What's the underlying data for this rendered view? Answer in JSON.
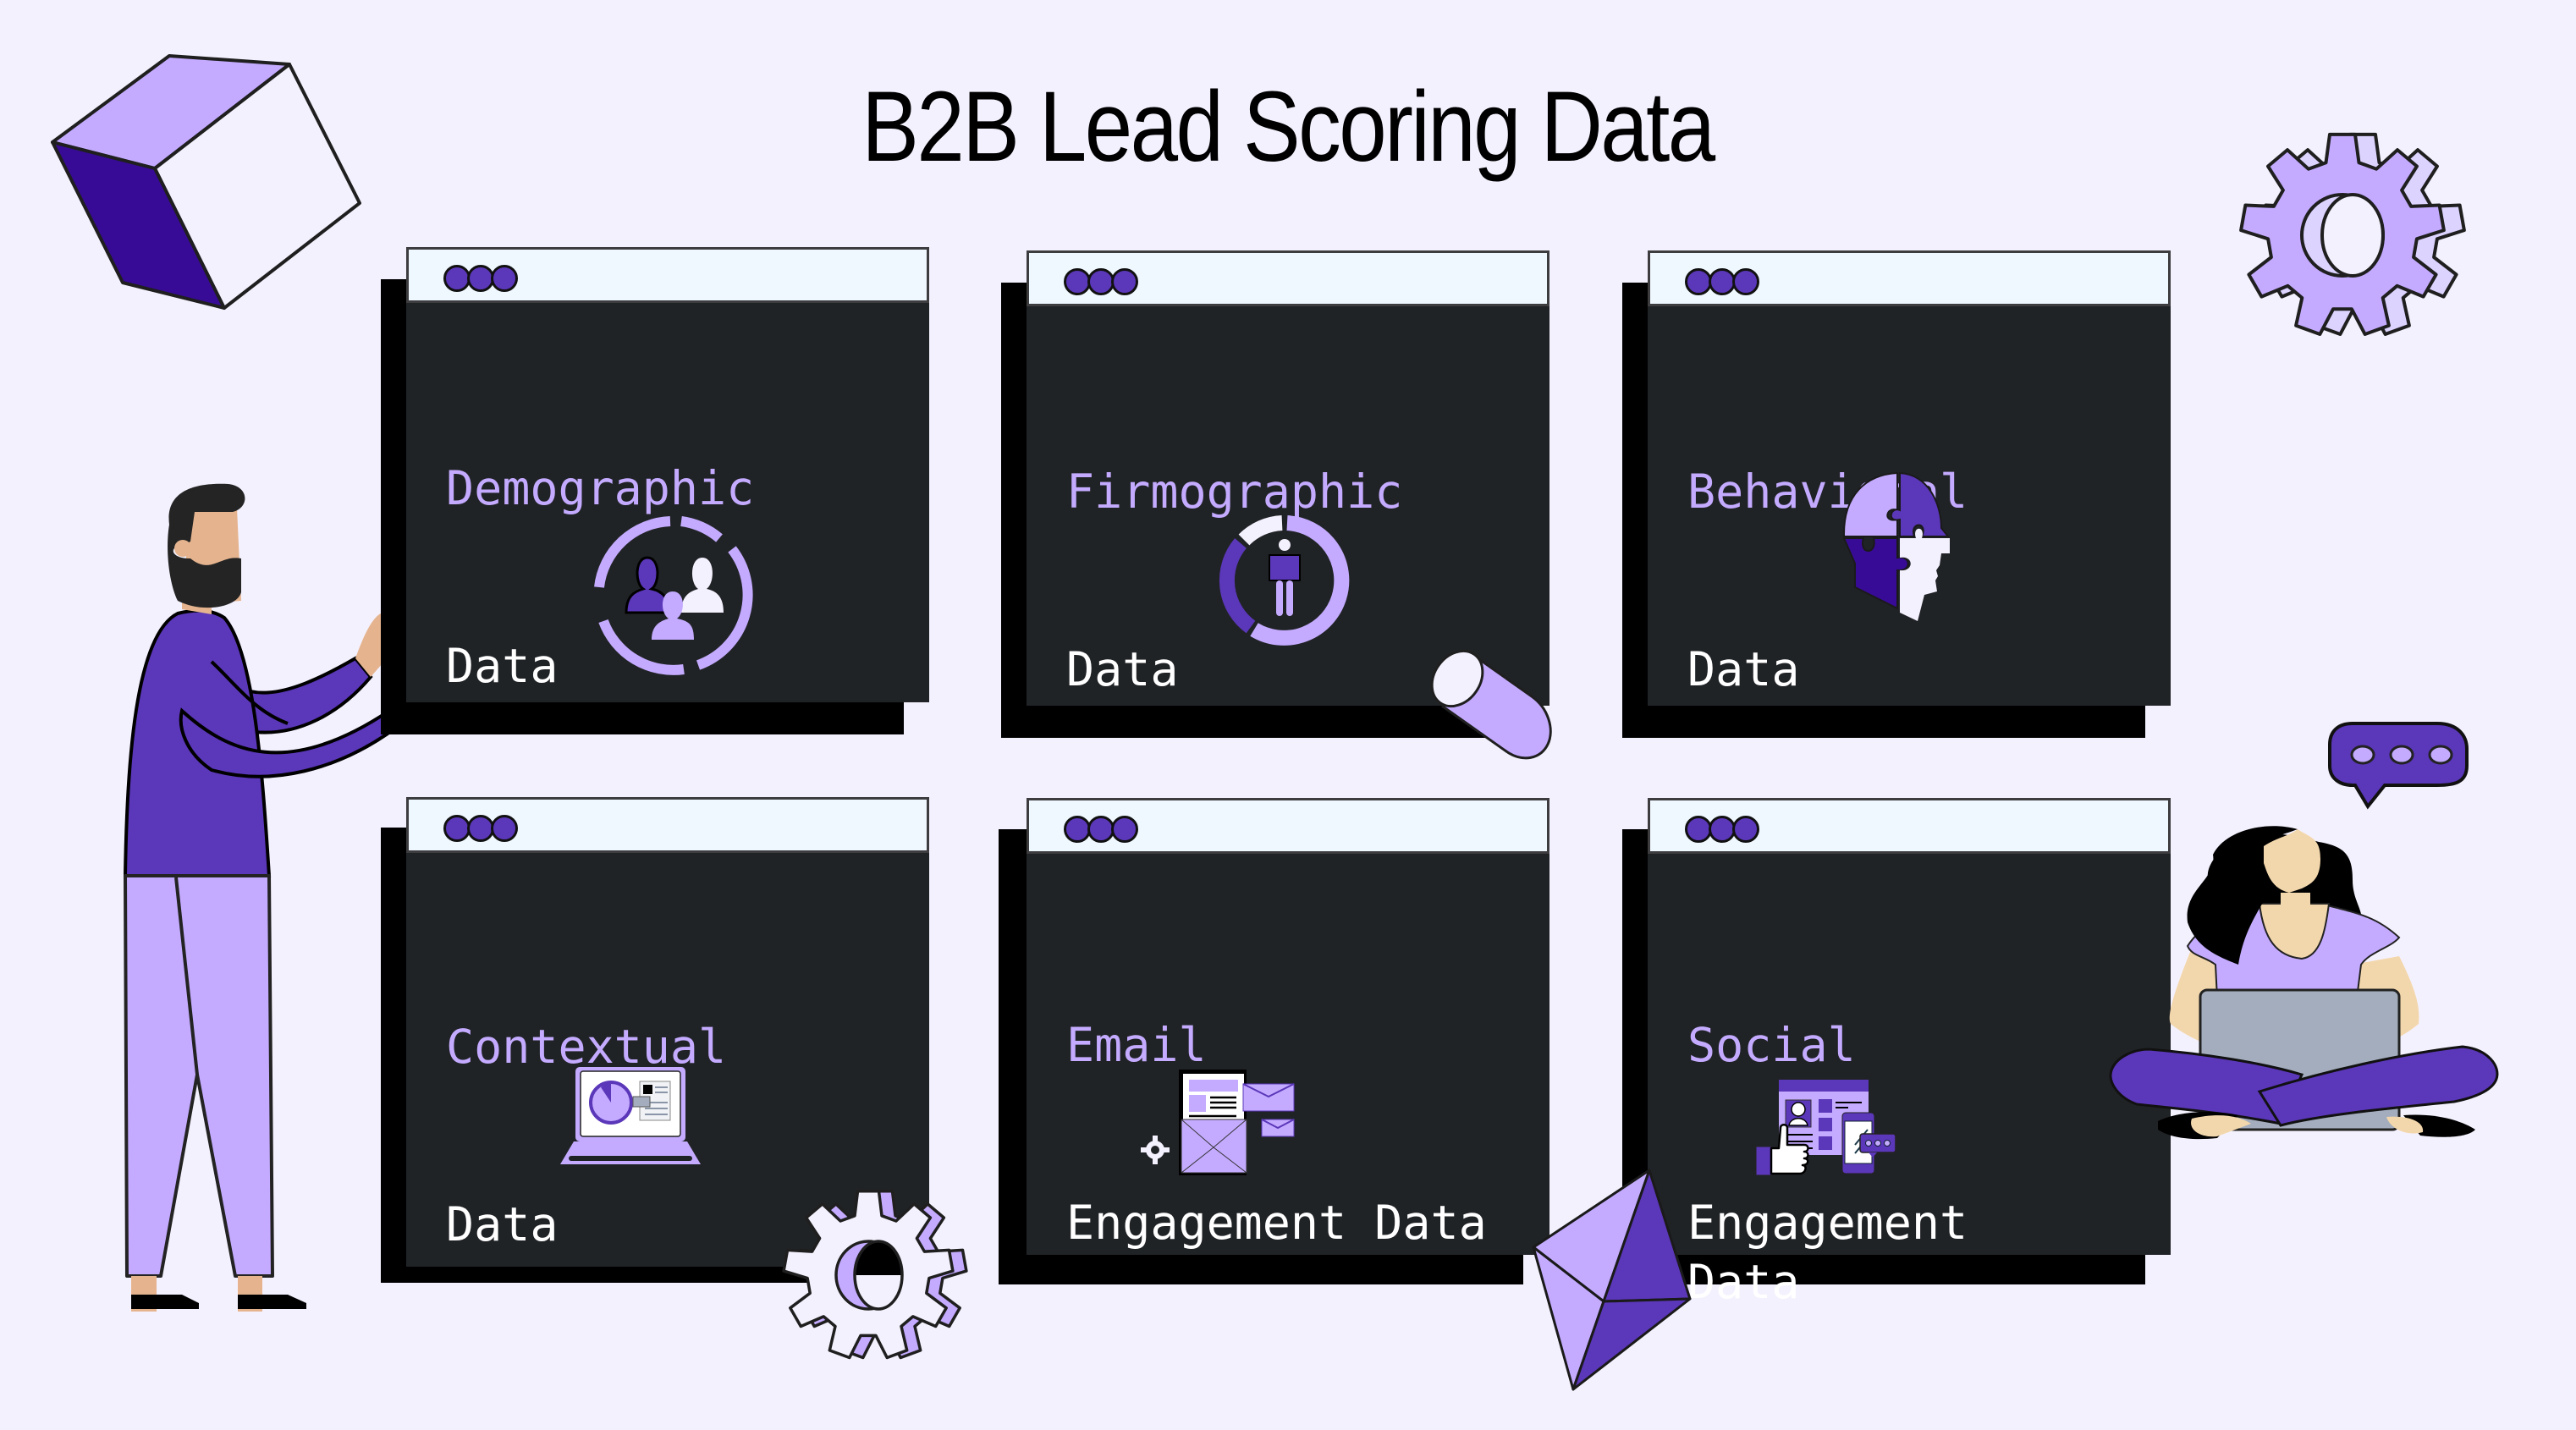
{
  "title": "B2B Lead Scoring Data",
  "colors": {
    "background": "#f4f1fe",
    "card_body": "#202326",
    "card_titlebar": "#eff7ff",
    "accent_light": "#c4abff",
    "accent_dark": "#5b37b9",
    "accent_deep": "#370b95",
    "text_white": "#ffffff"
  },
  "cards": [
    {
      "line1": "Demographic",
      "line2": "Data",
      "icon": "people-group-icon"
    },
    {
      "line1": "Firmographic",
      "line2": "Data",
      "icon": "person-donut-chart-icon"
    },
    {
      "line1": "Behavioral",
      "line2": "Data",
      "icon": "puzzle-head-icon"
    },
    {
      "line1": "Contextual",
      "line2": "Data",
      "icon": "laptop-analytics-icon"
    },
    {
      "line1": "Email",
      "line2": "Engagement Data",
      "icon": "email-envelopes-icon"
    },
    {
      "line1": "Social",
      "line2": "Engagement\nData",
      "icon": "social-like-profile-icon"
    }
  ],
  "decorations": {
    "left_figure": "bearded-man-illustration",
    "right_figure": "woman-with-laptop-illustration",
    "speech_bubble": "speech-bubble-dots-icon",
    "shapes": [
      "cube-icon",
      "gear-icon",
      "cylinder-icon",
      "gem-icon"
    ]
  }
}
